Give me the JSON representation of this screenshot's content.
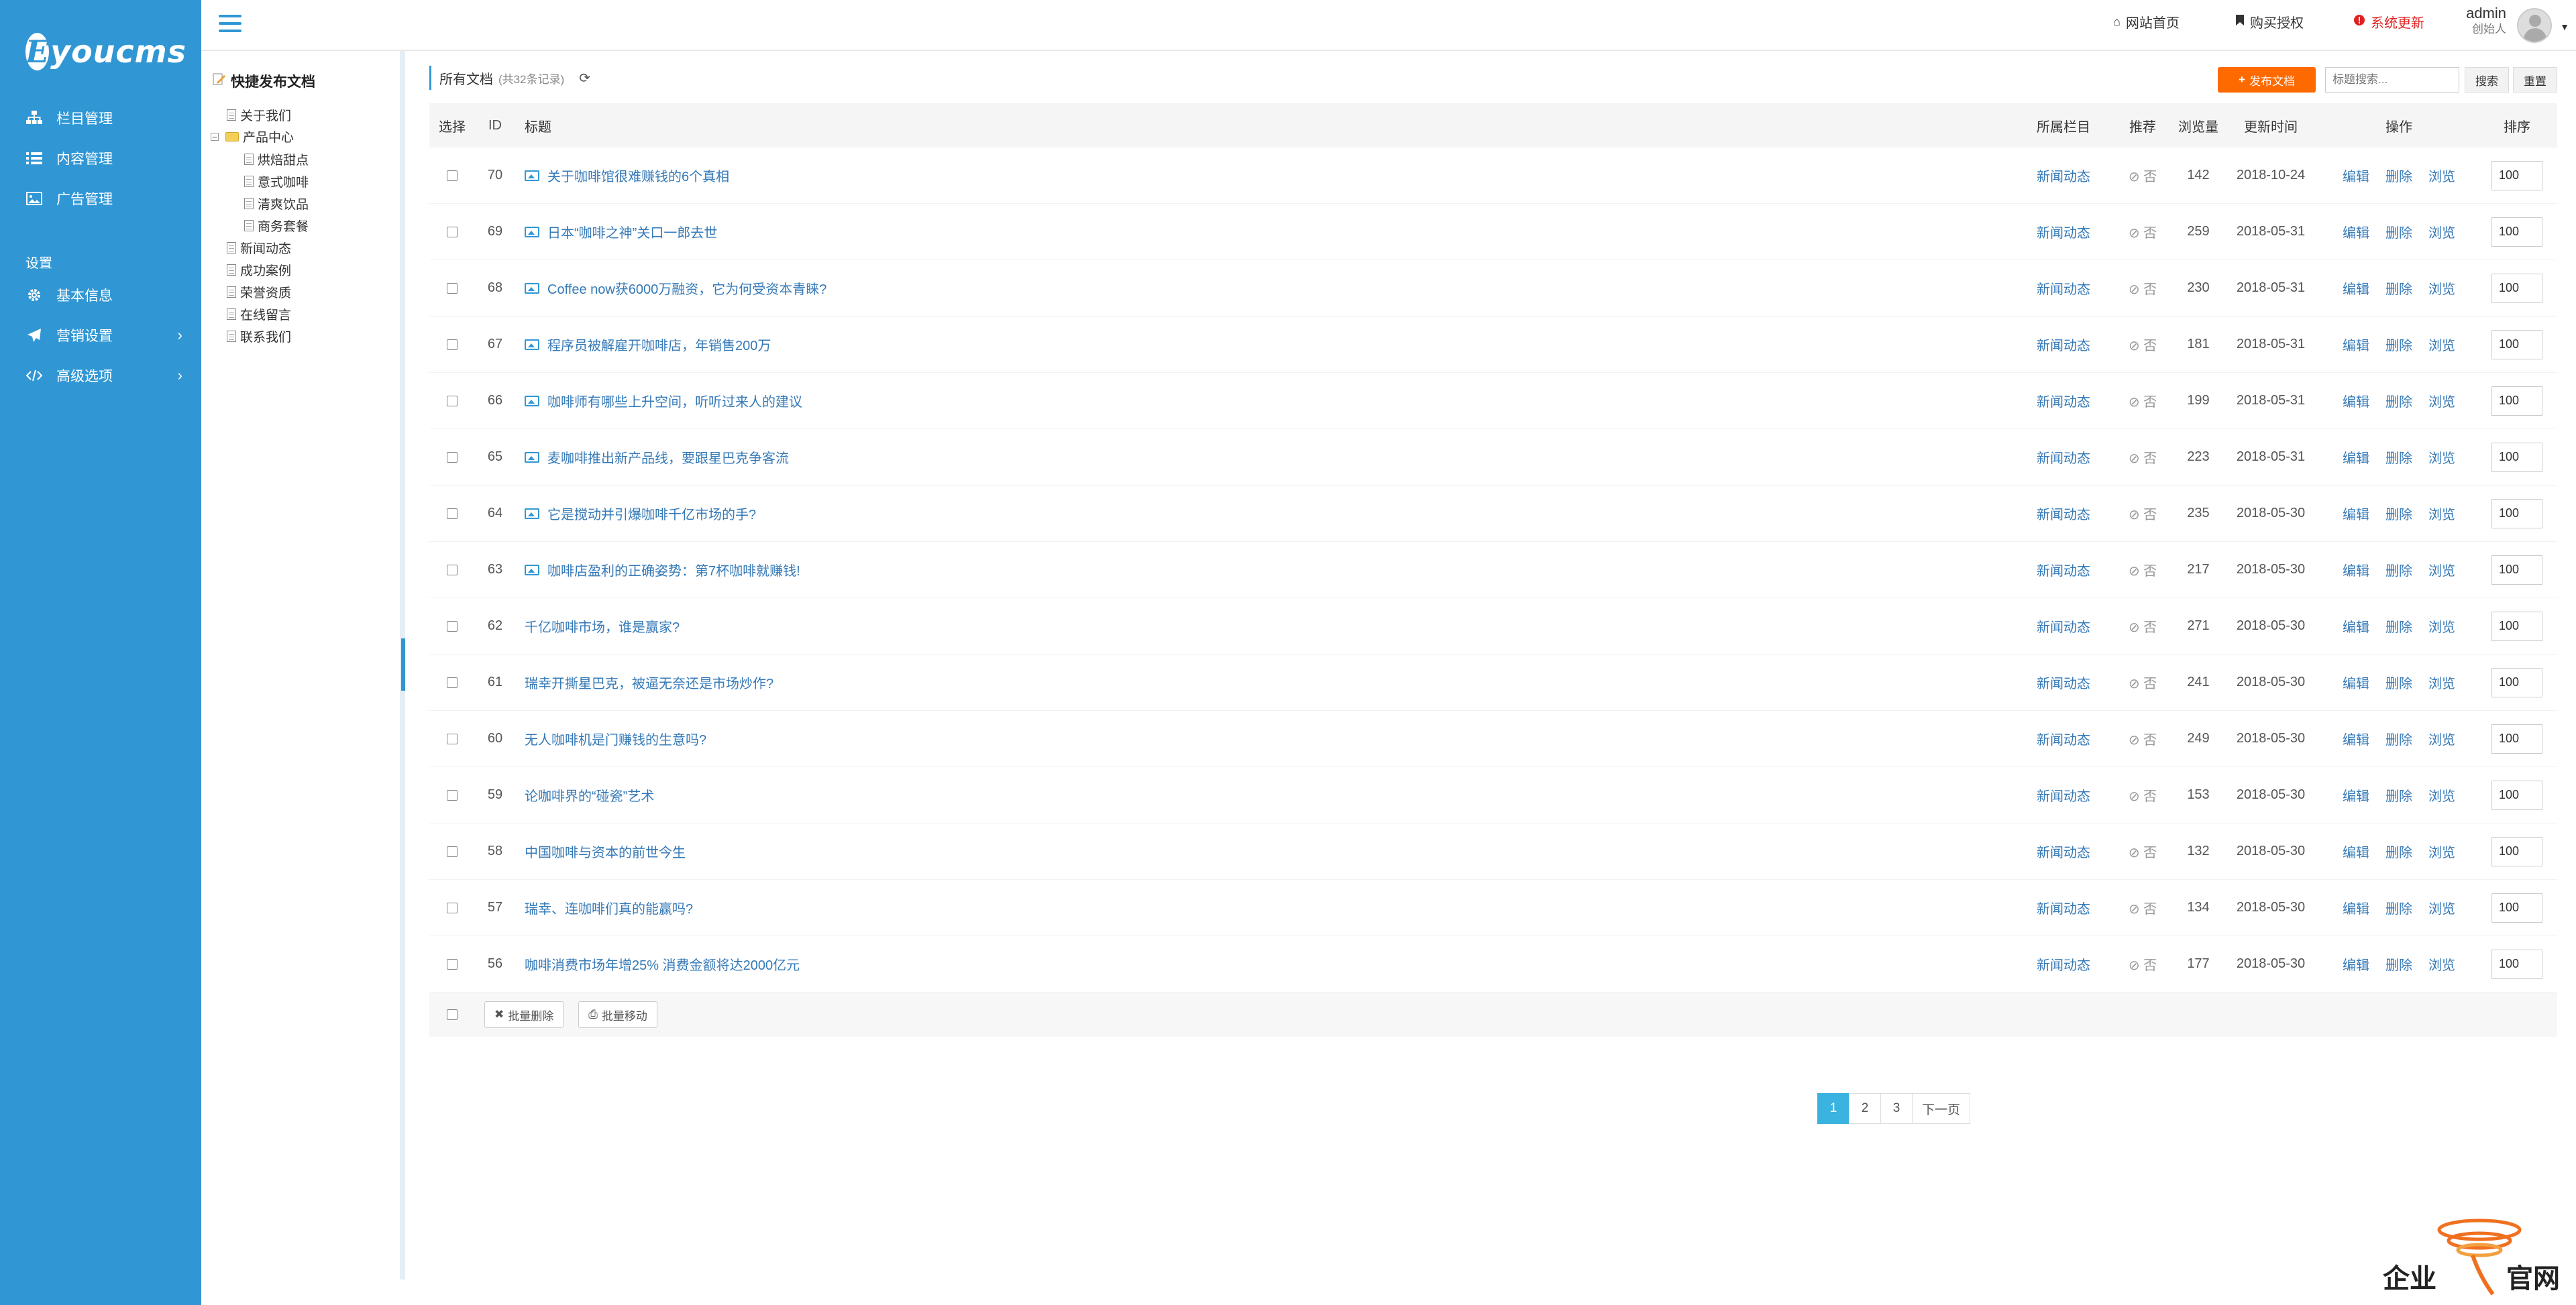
{
  "brand": {
    "logo_letter": "E",
    "logo_text": "youcms"
  },
  "sidebar": {
    "items": [
      {
        "label": "栏目管理",
        "icon": "sitemap-icon"
      },
      {
        "label": "内容管理",
        "icon": "list-icon"
      },
      {
        "label": "广告管理",
        "icon": "image-icon"
      }
    ],
    "section_label": "设置",
    "settings_items": [
      {
        "label": "基本信息",
        "icon": "gear-icon"
      },
      {
        "label": "营销设置",
        "icon": "paper-plane-icon"
      },
      {
        "label": "高级选项",
        "icon": "code-icon"
      }
    ]
  },
  "topbar": {
    "home_label": "网站首页",
    "license_label": "购买授权",
    "update_label": "系统更新",
    "user_name": "admin",
    "user_role": "创始人"
  },
  "tree": {
    "title": "快捷发布文档",
    "nodes": [
      {
        "label": "关于我们"
      },
      {
        "label": "产品中心"
      },
      {
        "label": "烘焙甜点"
      },
      {
        "label": "意式咖啡"
      },
      {
        "label": "清爽饮品"
      },
      {
        "label": "商务套餐"
      },
      {
        "label": "新闻动态"
      },
      {
        "label": "成功案例"
      },
      {
        "label": "荣誉资质"
      },
      {
        "label": "在线留言"
      },
      {
        "label": "联系我们"
      }
    ]
  },
  "toolbar": {
    "title": "所有文档",
    "count": "(共32条记录)",
    "publish_label": "发布文档",
    "search_placeholder": "标题搜索...",
    "search_label": "搜索",
    "reset_label": "重置"
  },
  "table": {
    "headers": {
      "select": "选择",
      "id": "ID",
      "title": "标题",
      "category": "所属栏目",
      "recommend": "推荐",
      "views": "浏览量",
      "updated": "更新时间",
      "ops": "操作",
      "sort": "排序"
    },
    "op_labels": {
      "edit": "编辑",
      "delete": "删除",
      "view": "浏览"
    },
    "rows": [
      {
        "id": "70",
        "title": "关于咖啡馆很难赚钱的6个真相",
        "pic": true,
        "category": "新闻动态",
        "recommend": "否",
        "views": "142",
        "date": "2018-10-24",
        "sort": "100"
      },
      {
        "id": "69",
        "title": "日本“咖啡之神”关口一郎去世",
        "pic": true,
        "category": "新闻动态",
        "recommend": "否",
        "views": "259",
        "date": "2018-05-31",
        "sort": "100"
      },
      {
        "id": "68",
        "title": "Coffee now获6000万融资，它为何受资本青睐?",
        "pic": true,
        "category": "新闻动态",
        "recommend": "否",
        "views": "230",
        "date": "2018-05-31",
        "sort": "100"
      },
      {
        "id": "67",
        "title": "程序员被解雇开咖啡店，年销售200万",
        "pic": true,
        "category": "新闻动态",
        "recommend": "否",
        "views": "181",
        "date": "2018-05-31",
        "sort": "100"
      },
      {
        "id": "66",
        "title": "咖啡师有哪些上升空间，听听过来人的建议",
        "pic": true,
        "category": "新闻动态",
        "recommend": "否",
        "views": "199",
        "date": "2018-05-31",
        "sort": "100"
      },
      {
        "id": "65",
        "title": "麦咖啡推出新产品线，要跟星巴克争客流",
        "pic": true,
        "category": "新闻动态",
        "recommend": "否",
        "views": "223",
        "date": "2018-05-31",
        "sort": "100"
      },
      {
        "id": "64",
        "title": "它是搅动并引爆咖啡千亿市场的手?",
        "pic": true,
        "category": "新闻动态",
        "recommend": "否",
        "views": "235",
        "date": "2018-05-30",
        "sort": "100"
      },
      {
        "id": "63",
        "title": "咖啡店盈利的正确姿势：第7杯咖啡就赚钱!",
        "pic": true,
        "category": "新闻动态",
        "recommend": "否",
        "views": "217",
        "date": "2018-05-30",
        "sort": "100"
      },
      {
        "id": "62",
        "title": "千亿咖啡市场，谁是赢家?",
        "pic": false,
        "category": "新闻动态",
        "recommend": "否",
        "views": "271",
        "date": "2018-05-30",
        "sort": "100"
      },
      {
        "id": "61",
        "title": "瑞幸开撕星巴克，被逼无奈还是市场炒作?",
        "pic": false,
        "category": "新闻动态",
        "recommend": "否",
        "views": "241",
        "date": "2018-05-30",
        "sort": "100"
      },
      {
        "id": "60",
        "title": "无人咖啡机是门赚钱的生意吗?",
        "pic": false,
        "category": "新闻动态",
        "recommend": "否",
        "views": "249",
        "date": "2018-05-30",
        "sort": "100"
      },
      {
        "id": "59",
        "title": "论咖啡界的“碰瓷”艺术",
        "pic": false,
        "category": "新闻动态",
        "recommend": "否",
        "views": "153",
        "date": "2018-05-30",
        "sort": "100"
      },
      {
        "id": "58",
        "title": "中国咖啡与资本的前世今生",
        "pic": false,
        "category": "新闻动态",
        "recommend": "否",
        "views": "132",
        "date": "2018-05-30",
        "sort": "100"
      },
      {
        "id": "57",
        "title": "瑞幸、连咖啡们真的能赢吗?",
        "pic": false,
        "category": "新闻动态",
        "recommend": "否",
        "views": "134",
        "date": "2018-05-30",
        "sort": "100"
      },
      {
        "id": "56",
        "title": "咖啡消费市场年增25% 消费金额将达2000亿元",
        "pic": false,
        "category": "新闻动态",
        "recommend": "否",
        "views": "177",
        "date": "2018-05-30",
        "sort": "100"
      }
    ],
    "batch_delete_label": "批量删除",
    "batch_move_label": "批量移动"
  },
  "pagination": {
    "pages": [
      "1",
      "2",
      "3"
    ],
    "active": "1",
    "next_label": "下一页"
  },
  "watermark": {
    "text_left": "企业",
    "text_right": "官网"
  },
  "colors": {
    "sidebar": "#3197d4",
    "accent_orange": "#ff6a00",
    "link": "#3479b7",
    "update_red": "#e02020",
    "page_active": "#3bb3e0"
  }
}
